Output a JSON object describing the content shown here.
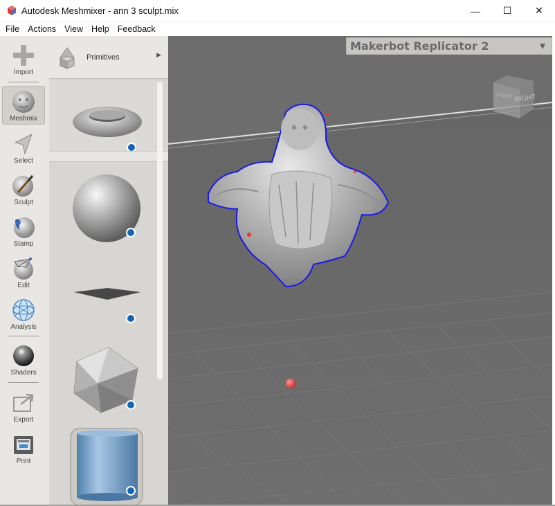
{
  "window": {
    "title": "Autodesk Meshmixer - ann 3 sculpt.mix",
    "minimize": "—",
    "maximize": "☐",
    "close": "✕"
  },
  "menu": {
    "items": [
      "File",
      "Actions",
      "View",
      "Help",
      "Feedback"
    ]
  },
  "tools": {
    "import": "Import",
    "meshmix": "Meshmix",
    "select": "Select",
    "sculpt": "Sculpt",
    "stamp": "Stamp",
    "edit": "Edit",
    "analysis": "Analysis",
    "shaders": "Shaders",
    "export": "Export",
    "print": "Print",
    "active": "Meshmix"
  },
  "primitives_panel": {
    "title": "Primitives",
    "items": [
      "torus",
      "sphere",
      "plane",
      "icosahedron",
      "cylinder"
    ],
    "selected": "cylinder"
  },
  "viewport": {
    "printer": "Makerbot Replicator 2",
    "navcube_front": "FRONT",
    "navcube_right": "RIGHT"
  },
  "colors": {
    "viewport_bg": "#6b6b6b",
    "boundary_blue": "#1a1ae6",
    "marker_red": "#e53935",
    "badge_blue": "#1565b5"
  }
}
